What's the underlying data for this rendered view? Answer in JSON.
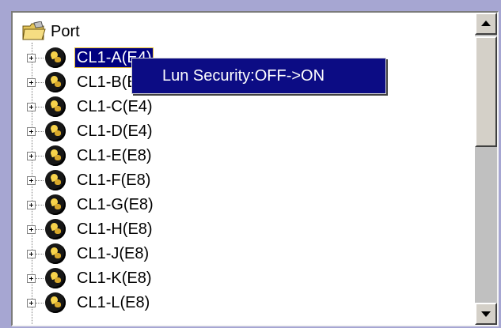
{
  "tree": {
    "root_label": "Port",
    "root_icon": "folder-icon",
    "items": [
      {
        "label": "CL1-A(E4)",
        "selected": true
      },
      {
        "label": "CL1-B(E4)"
      },
      {
        "label": "CL1-C(E4)"
      },
      {
        "label": "CL1-D(E4)"
      },
      {
        "label": "CL1-E(E8)"
      },
      {
        "label": "CL1-F(E8)"
      },
      {
        "label": "CL1-G(E8)"
      },
      {
        "label": "CL1-H(E8)"
      },
      {
        "label": "CL1-J(E8)"
      },
      {
        "label": "CL1-K(E8)"
      },
      {
        "label": "CL1-L(E8)"
      }
    ],
    "item_icon": "port-icon",
    "expander_icon": "plus-expander-icon"
  },
  "context_menu": {
    "items": [
      {
        "label": "Lun Security:OFF->ON"
      }
    ]
  },
  "scrollbar": {
    "up_icon": "scroll-up-arrow-icon",
    "down_icon": "scroll-down-arrow-icon"
  },
  "colors": {
    "background": "#a6a6d2",
    "selection": "#000080",
    "menu": "#0c0c84"
  }
}
